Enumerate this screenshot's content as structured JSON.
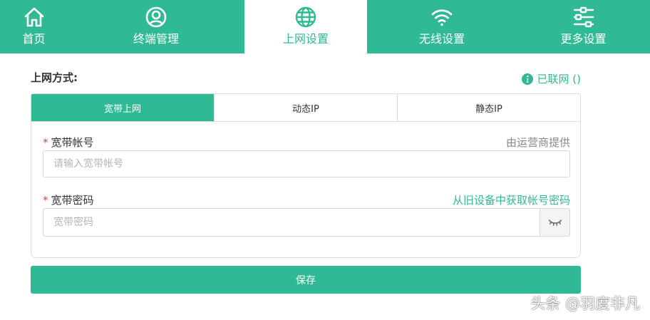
{
  "nav": {
    "items": [
      {
        "label": "首页",
        "icon": "home-icon"
      },
      {
        "label": "终端管理",
        "icon": "user-circle-icon"
      },
      {
        "label": "上网设置",
        "icon": "globe-icon",
        "active": true
      },
      {
        "label": "无线设置",
        "icon": "wifi-icon"
      },
      {
        "label": "更多设置",
        "icon": "sliders-icon"
      }
    ]
  },
  "section": {
    "title": "上网方式:",
    "status_text": "已联网 ()"
  },
  "mode_tabs": [
    "宽带上网",
    "动态IP",
    "静态IP"
  ],
  "form": {
    "account_label": "宽带帐号",
    "account_hint": "由运营商提供",
    "account_placeholder": "请输入宽带帐号",
    "password_label": "宽带密码",
    "password_link": "从旧设备中获取帐号密码",
    "password_placeholder": "宽带密码",
    "required_mark": "*"
  },
  "save_label": "保存",
  "watermark": "头条 @羽度非凡",
  "colors": {
    "accent": "#2fb994",
    "required": "#e2472f"
  }
}
